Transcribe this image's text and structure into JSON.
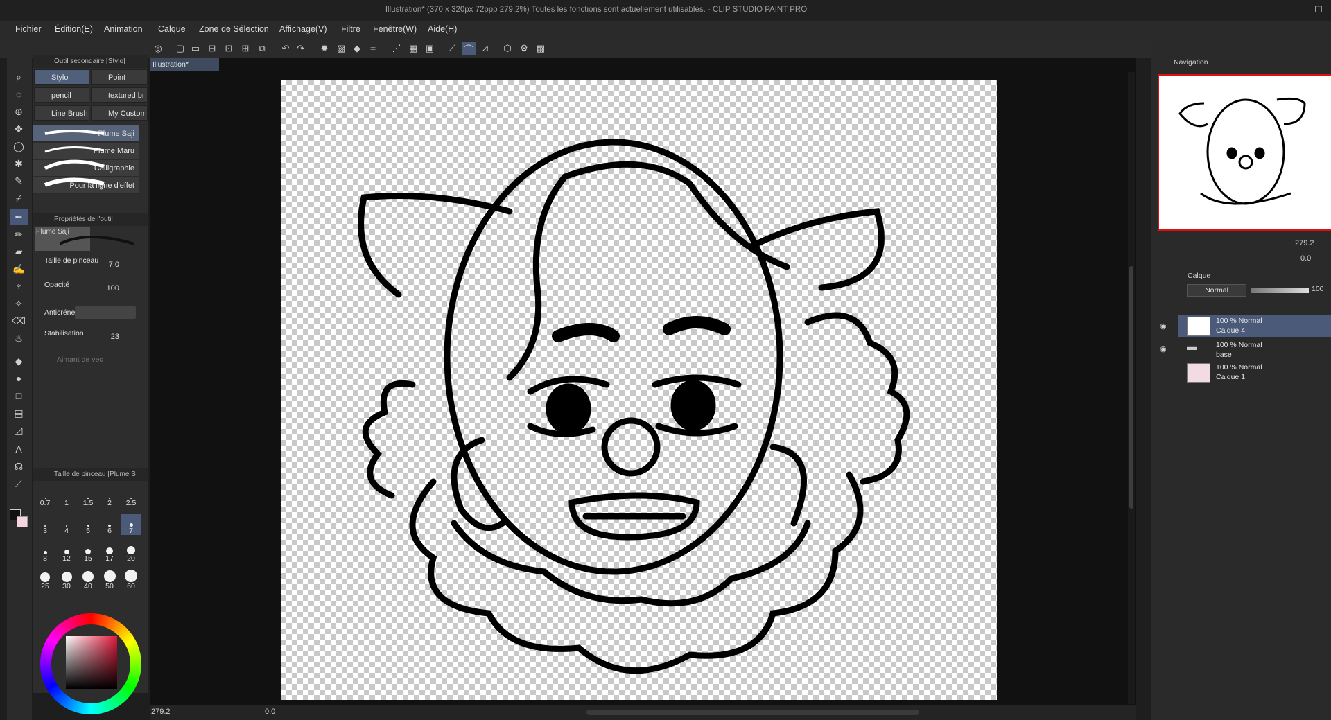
{
  "window": {
    "title": "Illustration* (370 x 320px 72ppp 279.2%)  Toutes les fonctions sont actuellement utilisables. - CLIP STUDIO PAINT PRO",
    "min": "—",
    "max": "☐",
    "close": "✕"
  },
  "menu": [
    "Fichier",
    "Édition(E)",
    "Animation",
    "Calque",
    "Zone de Sélection",
    "Affichage(V)",
    "Filtre",
    "Fenêtre(W)",
    "Aide(H)"
  ],
  "subtool": {
    "header": "Outil secondaire [Stylo]",
    "tabs": [
      "Stylo",
      "Point",
      "pencil",
      "textured br",
      "Line Brush",
      "My Custom"
    ],
    "brushes": [
      "Plume Saji",
      "Plume Maru",
      "Calligraphie",
      "Pour la ligne d'effet"
    ]
  },
  "props": {
    "header": "Propriétés de l'outil",
    "preview_label": "Plume Saji",
    "size_label": "Taille de pinceau",
    "size_value": "7.0",
    "opacity_label": "Opacité",
    "opacity_value": "100",
    "aa_label": "Anticrénel",
    "stab_label": "Stabilisation",
    "stab_value": "23",
    "vector_label": "Aimant de vec"
  },
  "brushsize": {
    "header": "Taille de pinceau [Plume S",
    "sizes": [
      "0.7",
      "1",
      "1.5",
      "2",
      "2.5",
      "3",
      "4",
      "5",
      "6",
      "7",
      "8",
      "12",
      "15",
      "17",
      "20",
      "25",
      "30",
      "40",
      "50",
      "60"
    ]
  },
  "document": {
    "tab": "Illustration*"
  },
  "status": {
    "zoom": "279.2",
    "angle": "0.0"
  },
  "navigator": {
    "title": "Navigation",
    "zoom": "279.2",
    "rotation": "0.0"
  },
  "layers": {
    "title": "Calque",
    "blend_mode": "Normal",
    "opacity": "100",
    "items": [
      {
        "mode": "100 % Normal",
        "name": "Calque 4"
      },
      {
        "mode": "100 % Normal",
        "name": "base"
      },
      {
        "mode": "100 % Normal",
        "name": "Calque 1"
      }
    ]
  },
  "colors": {
    "accent": "#4b5a78",
    "panel": "#2d2d2d",
    "bg": "#1e1e1e",
    "nav_border": "#e01010"
  }
}
